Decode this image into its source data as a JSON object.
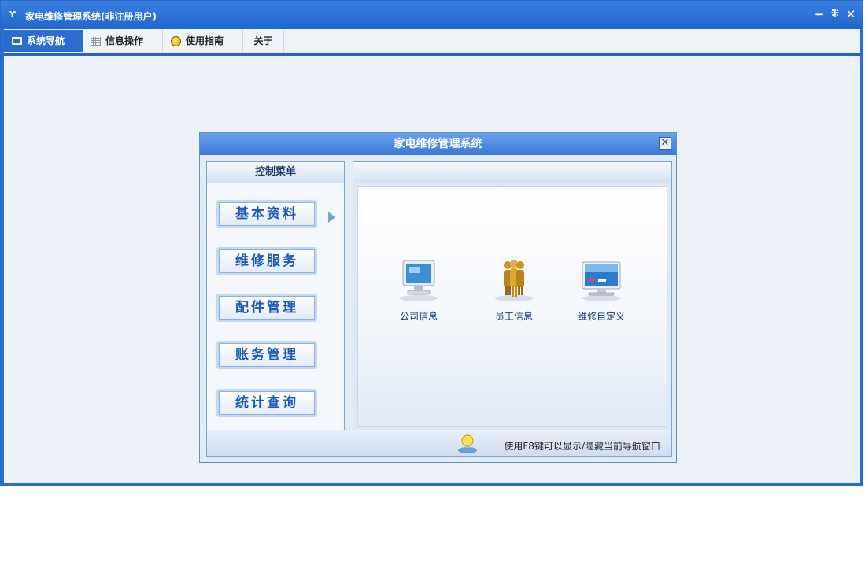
{
  "window": {
    "title": "家电维修管理系统(非注册用户)",
    "logo_glyph": "Ƴ",
    "minimize_glyph": "−",
    "restore_glyph": "⁜",
    "close_glyph": "✕"
  },
  "tabs": [
    {
      "label": "系统导航",
      "icon": "monitor-icon",
      "active": true
    },
    {
      "label": "信息操作",
      "icon": "grid-icon",
      "active": false
    },
    {
      "label": "使用指南",
      "icon": "bulb-icon",
      "active": false
    },
    {
      "label": "关于",
      "icon": "",
      "active": false
    }
  ],
  "dialog": {
    "title": "家电维修管理系统",
    "close_glyph": "✕",
    "menu_header": "控制菜单",
    "menu_items": [
      {
        "label": "基本资料",
        "selected": true
      },
      {
        "label": "维修服务",
        "selected": false
      },
      {
        "label": "配件管理",
        "selected": false
      },
      {
        "label": "账务管理",
        "selected": false
      },
      {
        "label": "统计查询",
        "selected": false
      }
    ],
    "tiles": [
      {
        "label": "公司信息",
        "icon": "computer-icon"
      },
      {
        "label": "员工信息",
        "icon": "people-icon"
      },
      {
        "label": "维修自定义",
        "icon": "monitor-screen-icon"
      }
    ],
    "status_hint": "使用F8键可以显示/隐藏当前导航窗口"
  },
  "colors": {
    "title_bar": "#2b6fd0",
    "client_bg": "#ecf2f8",
    "menu_text": "#1c59b8"
  }
}
